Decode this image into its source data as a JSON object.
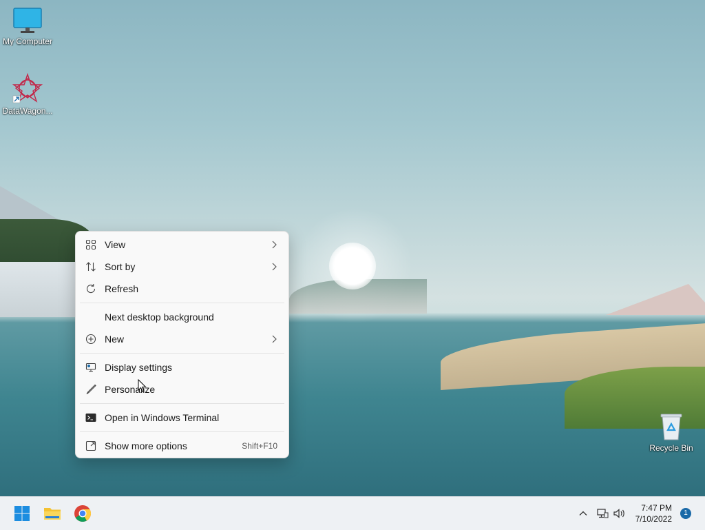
{
  "desktop": {
    "icons": [
      {
        "label": "My Computer",
        "icon": "monitor-icon"
      },
      {
        "label": "DataWagon...",
        "icon": "datawagon-app-icon"
      },
      {
        "label": "Recycle Bin",
        "icon": "recycle-bin-icon"
      }
    ]
  },
  "context_menu": {
    "items": {
      "view": {
        "label": "View",
        "icon": "grid-view-icon",
        "submenu": true
      },
      "sort_by": {
        "label": "Sort by",
        "icon": "sort-icon",
        "submenu": true
      },
      "refresh": {
        "label": "Refresh",
        "icon": "refresh-icon"
      },
      "next_bg": {
        "label": "Next desktop background"
      },
      "new": {
        "label": "New",
        "icon": "plus-circle-icon",
        "submenu": true
      },
      "display_settings": {
        "label": "Display settings",
        "icon": "display-settings-icon"
      },
      "personalize": {
        "label": "Personalize",
        "icon": "brush-icon"
      },
      "terminal": {
        "label": "Open in Windows Terminal",
        "icon": "terminal-icon"
      },
      "more_options": {
        "label": "Show more options",
        "icon": "more-options-icon",
        "accelerator": "Shift+F10"
      }
    }
  },
  "taskbar": {
    "pinned": [
      "start-icon",
      "file-explorer-icon",
      "chrome-icon"
    ],
    "tray": {
      "time": "7:47 PM",
      "date": "7/10/2022",
      "notification_count": "1"
    }
  },
  "colors": {
    "accent": "#1a6aa8",
    "menu_bg": "#f9f9f9",
    "taskbar_bg": "#eef1f4"
  }
}
